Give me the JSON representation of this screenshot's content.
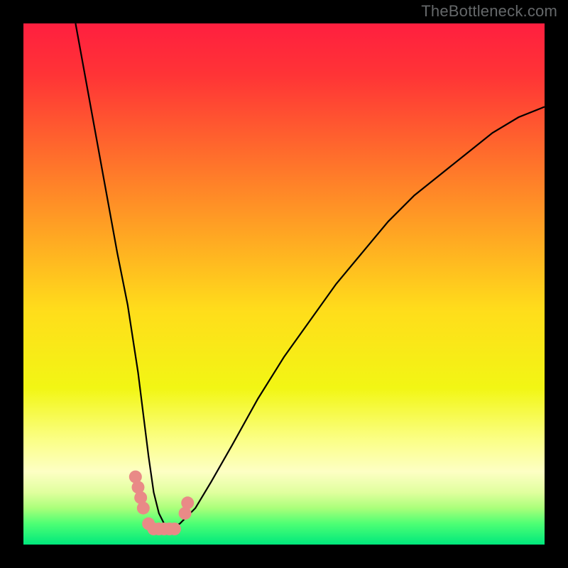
{
  "watermark": "TheBottleneck.com",
  "chart_data": {
    "type": "line",
    "title": "",
    "xlabel": "",
    "ylabel": "",
    "xlim": [
      0,
      100
    ],
    "ylim": [
      0,
      100
    ],
    "grid": false,
    "legend": false,
    "background_gradient": {
      "stops": [
        {
          "offset": 0.0,
          "color": "#ff1f3f"
        },
        {
          "offset": 0.1,
          "color": "#ff3436"
        },
        {
          "offset": 0.25,
          "color": "#ff6c2c"
        },
        {
          "offset": 0.4,
          "color": "#ffa423"
        },
        {
          "offset": 0.55,
          "color": "#ffdd1b"
        },
        {
          "offset": 0.7,
          "color": "#f2f614"
        },
        {
          "offset": 0.8,
          "color": "#fbff87"
        },
        {
          "offset": 0.86,
          "color": "#fdffc4"
        },
        {
          "offset": 0.9,
          "color": "#e0ff9e"
        },
        {
          "offset": 0.93,
          "color": "#aaff7a"
        },
        {
          "offset": 0.96,
          "color": "#4dff74"
        },
        {
          "offset": 1.0,
          "color": "#00e87c"
        }
      ]
    },
    "series": [
      {
        "name": "bottleneck-curve",
        "color": "#000000",
        "x": [
          10,
          12,
          14,
          16,
          18,
          20,
          22,
          23,
          24,
          25,
          26,
          27,
          28,
          30,
          33,
          36,
          40,
          45,
          50,
          55,
          60,
          65,
          70,
          75,
          80,
          85,
          90,
          95,
          100
        ],
        "values": [
          100,
          89,
          78,
          67,
          56,
          46,
          33,
          25,
          17,
          10,
          6,
          4,
          3,
          4,
          7,
          12,
          19,
          28,
          36,
          43,
          50,
          56,
          62,
          67,
          71,
          75,
          79,
          82,
          84
        ]
      }
    ],
    "markers": [
      {
        "name": "bottleneck-markers",
        "color": "#e98a87",
        "radius": 9,
        "points": [
          {
            "x": 21.5,
            "y": 13
          },
          {
            "x": 22.0,
            "y": 11
          },
          {
            "x": 22.5,
            "y": 9
          },
          {
            "x": 23.0,
            "y": 7
          },
          {
            "x": 24.0,
            "y": 4
          },
          {
            "x": 25.0,
            "y": 3
          },
          {
            "x": 26.0,
            "y": 3
          },
          {
            "x": 27.0,
            "y": 3
          },
          {
            "x": 28.0,
            "y": 3
          },
          {
            "x": 29.0,
            "y": 3
          },
          {
            "x": 31.0,
            "y": 6
          },
          {
            "x": 31.5,
            "y": 8
          }
        ]
      }
    ]
  }
}
